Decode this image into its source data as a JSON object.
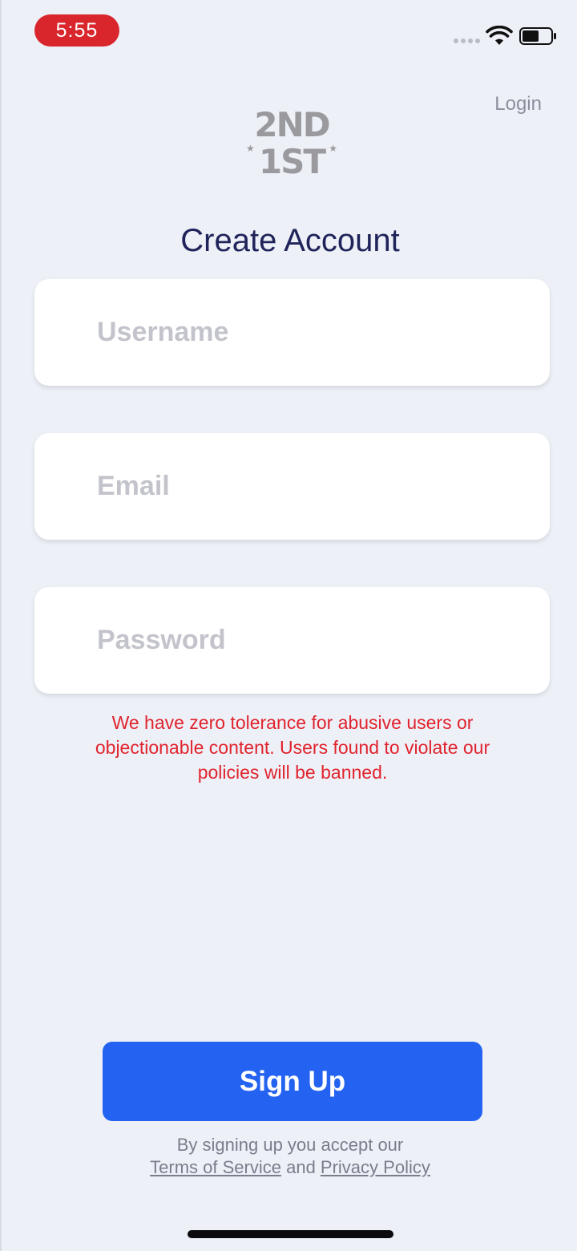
{
  "status_bar": {
    "time": "5:55"
  },
  "header": {
    "login_label": "Login"
  },
  "logo": {
    "line1": "2ND",
    "line2": "1ST",
    "star": "★"
  },
  "page": {
    "title": "Create Account"
  },
  "form": {
    "username_placeholder": "Username",
    "email_placeholder": "Email",
    "password_placeholder": "Password",
    "warning": "We have zero tolerance for abusive users or objectionable content. Users found to violate our policies will be banned."
  },
  "actions": {
    "signup_label": "Sign Up"
  },
  "terms": {
    "prefix": "By signing up you accept our",
    "tos_label": "Terms of Service",
    "conjunction": "and",
    "privacy_label": "Privacy Policy"
  },
  "colors": {
    "background": "#eef0f8",
    "accent": "#2463f2",
    "title": "#1f2359",
    "warning": "#e0242d",
    "time_badge": "#d9262c"
  }
}
